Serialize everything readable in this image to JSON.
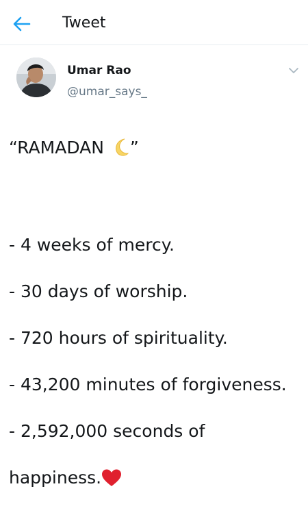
{
  "header": {
    "title": "Tweet",
    "back_icon": "arrow-left-icon",
    "accent_color": "#1da1f2"
  },
  "author": {
    "name": "Umar Rao",
    "handle": "@umar_says_",
    "avatar_icon": "profile-photo",
    "menu_icon": "chevron-down-icon"
  },
  "tweet": {
    "line1_open": "“RAMADAN ",
    "line1_close": "”",
    "line2": "- 4 weeks of mercy.",
    "line3": "- 30 days of worship.",
    "line4": "- 720 hours of spirituality.",
    "line5": "- 43,200 minutes of forgiveness.",
    "line6": "- 2,592,000 seconds of",
    "line7": "happiness.",
    "emoji_moon": "crescent-moon-emoji",
    "emoji_heart": "red-heart-emoji"
  }
}
